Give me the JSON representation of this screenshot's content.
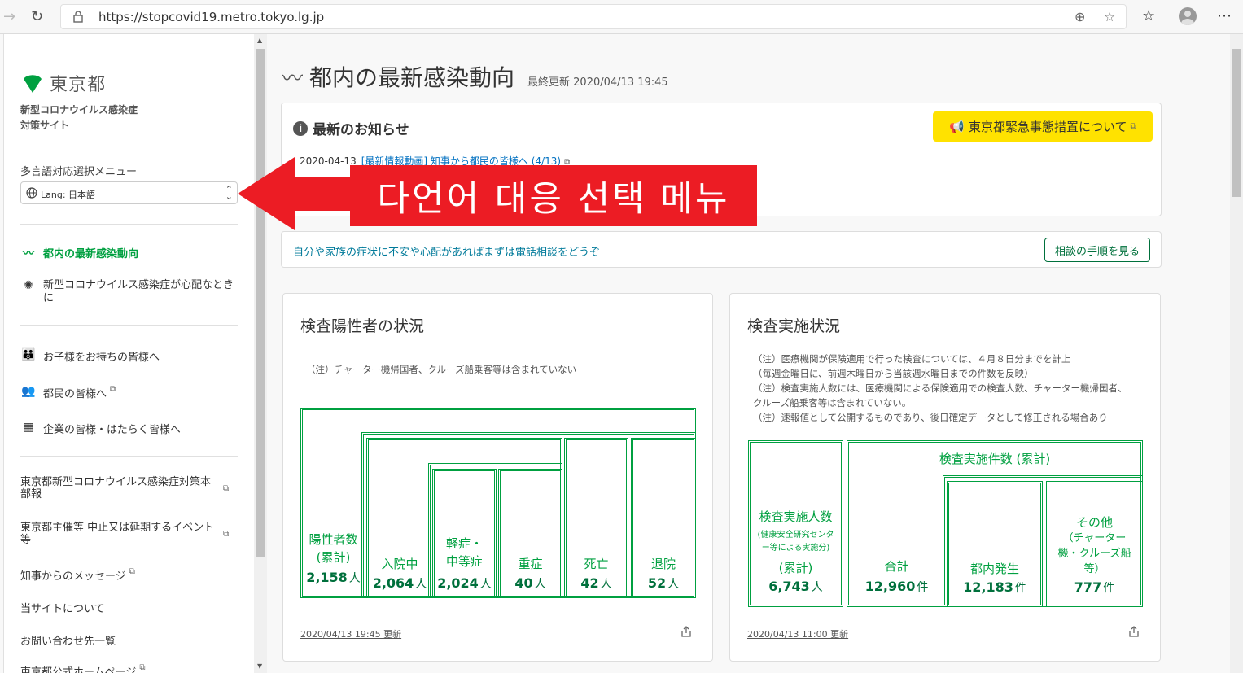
{
  "browser": {
    "url": "https://stopcovid19.metro.tokyo.lg.jp"
  },
  "sidebar": {
    "logo_text": "東京都",
    "site_title_line1": "新型コロナウイルス感染症",
    "site_title_line2": "対策サイト",
    "lang_menu_label": "多言語対応選択メニュー",
    "lang_select_value": "Lang:  日本語",
    "nav_primary": [
      {
        "label": "都内の最新感染動向",
        "icon": "trend-icon",
        "active": true
      },
      {
        "label": "新型コロナウイルス感染症が心配なときに",
        "icon": "virus-icon",
        "active": false
      }
    ],
    "nav_secondary": [
      {
        "label": "お子様をお持ちの皆様へ",
        "icon": "parent-child-icon"
      },
      {
        "label": "都民の皆様へ",
        "icon": "people-icon"
      },
      {
        "label": "企業の皆様・はたらく皆様へ",
        "icon": "building-icon"
      }
    ],
    "nav_links": [
      {
        "label": "東京都新型コロナウイルス感染症対策本部報"
      },
      {
        "label": "東京都主催等 中止又は延期するイベント等"
      },
      {
        "label": "知事からのメッセージ"
      },
      {
        "label": "当サイトについて"
      },
      {
        "label": "お問い合わせ先一覧"
      },
      {
        "label": "東京都公式ホームページ"
      }
    ]
  },
  "main": {
    "title": "都内の最新感染動向",
    "last_updated": "最終更新 2020/04/13 19:45",
    "news": {
      "heading": "最新のお知らせ",
      "emergency_button": "東京都緊急事態措置について",
      "item_date": "2020-04-13",
      "item_text": "[最新情報動画] 知事から都民の皆様へ (4/13)"
    },
    "consult": {
      "text": "自分や家族の症状に不安や心配があればまずは電話相談をどうぞ",
      "button": "相談の手順を見る"
    },
    "positives": {
      "title": "検査陽性者の状況",
      "note": "（注）チャーター機帰国者、クルーズ船乗客等は含まれていない",
      "footer": "2020/04/13 19:45 更新",
      "boxes": [
        {
          "label1": "陽性者数",
          "label2": "(累計)",
          "value": "2,158",
          "unit": "人"
        },
        {
          "label1": "入院中",
          "value": "2,064",
          "unit": "人"
        },
        {
          "label1": "軽症・",
          "label2": "中等症",
          "value": "2,024",
          "unit": "人"
        },
        {
          "label1": "重症",
          "value": "40",
          "unit": "人"
        },
        {
          "label1": "死亡",
          "value": "42",
          "unit": "人"
        },
        {
          "label1": "退院",
          "value": "52",
          "unit": "人"
        }
      ]
    },
    "tests": {
      "title": "検査実施状況",
      "notes": [
        "（注）医療機関が保険適用で行った検査については、４月８日分までを計上",
        "（毎週金曜日に、前週木曜日から当該週水曜日までの件数を反映）",
        "（注）検査実施人数には、医療機関による保険適用での検査人数、チャーター機帰国者、",
        "クルーズ船乗客等は含まれていない。",
        "（注）速報値として公開するものであり、後日確定データとして修正される場合あり"
      ],
      "footer": "2020/04/13 11:00 更新",
      "people_box": {
        "label1": "検査実施人数",
        "small1": "(健康安全研究センタ",
        "small2": "ー等による実施分)",
        "label2": "(累計)",
        "value": "6,743",
        "unit": "人"
      },
      "total_header": "検査実施件数 (累計)",
      "boxes": [
        {
          "label1": "合計",
          "value": "12,960",
          "unit": "件"
        },
        {
          "label1": "都内発生",
          "value": "12,183",
          "unit": "件"
        },
        {
          "label1": "その他",
          "label2": "（チャーター",
          "label3": "機・クルーズ船",
          "label4": "等）",
          "value": "777",
          "unit": "件"
        }
      ]
    }
  },
  "annotation": {
    "banner_text": "다언어 대응 선택 메뉴",
    "color": "#ec1c24"
  }
}
